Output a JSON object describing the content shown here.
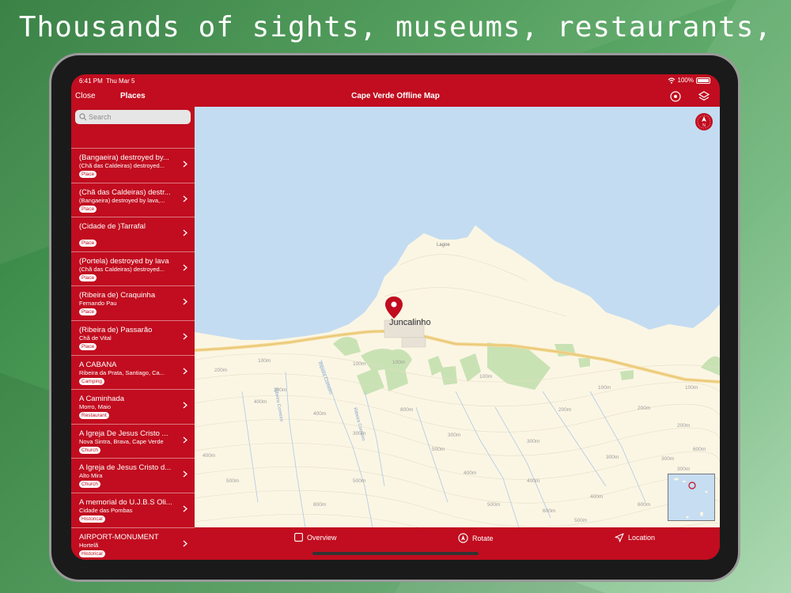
{
  "headline": "Thousands of sights, museums, restaurants, ...",
  "status": {
    "time": "6:41 PM",
    "date": "Thu Mar 5",
    "battery": "100%"
  },
  "nav": {
    "close": "Close",
    "places": "Places",
    "title": "Cape Verde Offline Map"
  },
  "search": {
    "placeholder": "Search"
  },
  "places": [
    {
      "name": "(Bangaeira) destroyed by...",
      "sub": "(Chã das Caldeiras) destroyed...",
      "tag": "Place"
    },
    {
      "name": "(Chã das Caldeiras) destr...",
      "sub": "(Bangaeira) destroyed by lava,...",
      "tag": "Place"
    },
    {
      "name": "(Cidade de )Tarrafal",
      "sub": "",
      "tag": "Place"
    },
    {
      "name": "(Portela) destroyed by lava",
      "sub": "(Chã das Caldeiras) destroyed...",
      "tag": "Place"
    },
    {
      "name": "(Ribeira de) Craquinha",
      "sub": "Fernando Pau",
      "tag": "Place"
    },
    {
      "name": "(Ribeira de) Passarão",
      "sub": "Chã de Vital",
      "tag": "Place"
    },
    {
      "name": "A CABANA",
      "sub": "Ribeira da Prata, Santiago, Ca...",
      "tag": "Camping"
    },
    {
      "name": "A Caminhada",
      "sub": "Morro, Maio",
      "tag": "Restaurant"
    },
    {
      "name": "A Igreja De Jesus Cristo ...",
      "sub": "Nova Sintra, Brava, Cape Verde",
      "tag": "Church"
    },
    {
      "name": "A Igreja de Jesus Cristo d...",
      "sub": "Alto Mira",
      "tag": "Church"
    },
    {
      "name": "A memorial do U.J.B.S Oli...",
      "sub": "Cidade das Pombas",
      "tag": "Historical"
    },
    {
      "name": "AIRPORT-MONUMENT",
      "sub": "Hortelã",
      "tag": "Historical"
    }
  ],
  "map": {
    "pin_label": "Juncalinho",
    "small_label": "Lagoe",
    "contours": [
      "100m",
      "100m",
      "100m",
      "100m",
      "100m",
      "100m",
      "200m",
      "200m",
      "200m",
      "200m",
      "200m",
      "300m",
      "300m",
      "300m",
      "300m",
      "300m",
      "300m",
      "400m",
      "400m",
      "400m",
      "400m",
      "400m",
      "400m",
      "500m",
      "500m",
      "500m",
      "500m",
      "500m",
      "600m",
      "600m",
      "600m",
      "800m",
      "800m"
    ],
    "streams": [
      "Ribeira Comeiro",
      "Ribeira Comeiro",
      "Ribeira Comeiro"
    ]
  },
  "toolbar": {
    "overview": "Overview",
    "rotate": "Rotate",
    "location": "Location"
  },
  "colors": {
    "accent": "#c10d1f",
    "sea": "#c4dcf1",
    "land": "#fbf6e4",
    "vegetation": "#c9e2b4"
  }
}
